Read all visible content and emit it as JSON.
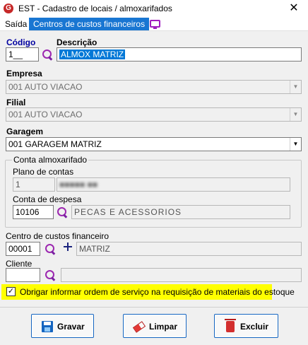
{
  "window": {
    "title": "EST - Cadastro de locais / almoxarifados",
    "app_icon": "G",
    "close": "✕"
  },
  "menu": {
    "items": [
      "Saída",
      "Centros de custos financeiros"
    ],
    "active_index": 1
  },
  "codigo": {
    "label": "Código",
    "value": "1__"
  },
  "descricao": {
    "label": "Descrição",
    "value": "ALMOX MATRIZ"
  },
  "empresa": {
    "label": "Empresa",
    "value": "001 AUTO VIACAO"
  },
  "filial": {
    "label": "Filial",
    "value": "001 AUTO VIACAO"
  },
  "garagem": {
    "label": "Garagem",
    "value": "001 GARAGEM MATRIZ"
  },
  "conta_almoxarifado": {
    "group_title": "Conta almoxarifado",
    "plano_label": "Plano de contas",
    "plano_value": "1",
    "plano_desc_blurred": "■■■■■ ■■",
    "despesa_label": "Conta de despesa",
    "despesa_value": "10106",
    "despesa_desc": "PECAS E ACESSORIOS"
  },
  "centro_custos": {
    "label": "Centro de custos financeiro",
    "value": "00001",
    "desc": "MATRIZ"
  },
  "cliente": {
    "label": "Cliente",
    "value": "",
    "desc": ""
  },
  "obrigar_os": {
    "checked": true,
    "check_mark": "✓",
    "label": "Obrigar informar ordem de serviço na requisição de materiais do estoque"
  },
  "buttons": {
    "gravar": "Gravar",
    "limpar": "Limpar",
    "excluir": "Excluir"
  },
  "colors": {
    "accent": "#1976d2",
    "highlight": "#ffff00",
    "search_icon": "#9c27b0"
  }
}
